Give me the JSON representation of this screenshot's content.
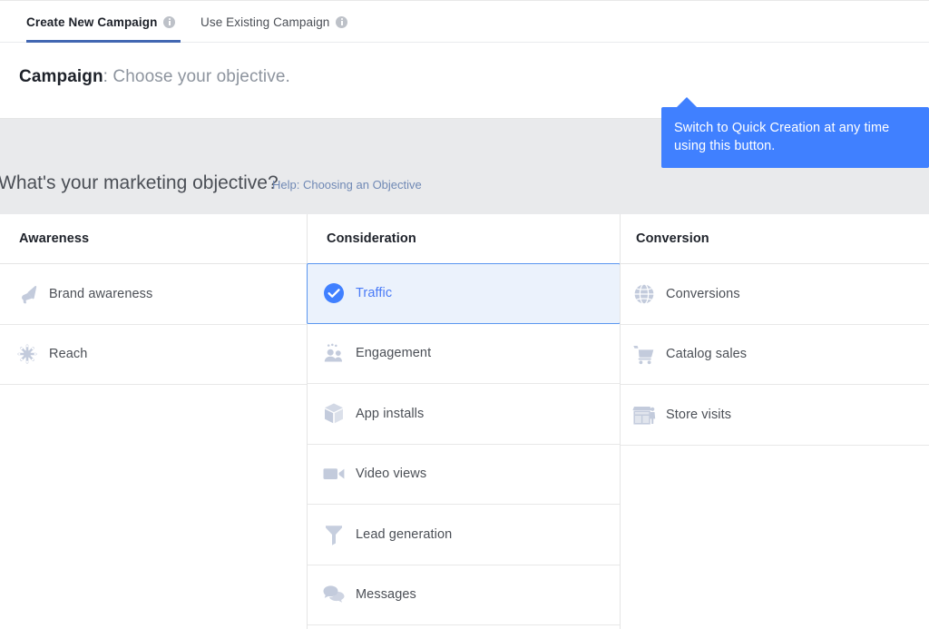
{
  "tabs": [
    {
      "label": "Create New Campaign",
      "icon": "info-icon",
      "active": true
    },
    {
      "label": "Use Existing Campaign",
      "icon": "info-icon",
      "active": false
    }
  ],
  "campaign_header": {
    "title_bold": "Campaign",
    "title_rest": ": Choose your objective.",
    "quick_creation_button": "Switch to Quick Creation"
  },
  "tooltip": {
    "text": "Switch to Quick Creation at any time using this button.",
    "background_color": "#4080ff",
    "text_color": "#ffffff"
  },
  "objective_section": {
    "question": "What's your marketing objective?",
    "help_link": "Help: Choosing an Objective",
    "band_color": "#e9eaec"
  },
  "columns": [
    {
      "header": "Awareness",
      "items": [
        {
          "label": "Brand awareness",
          "icon": "megaphone-icon",
          "selected": false
        },
        {
          "label": "Reach",
          "icon": "reach-burst-icon",
          "selected": false
        }
      ]
    },
    {
      "header": "Consideration",
      "items": [
        {
          "label": "Traffic",
          "icon": "check-circle-icon",
          "selected": true
        },
        {
          "label": "Engagement",
          "icon": "people-icon",
          "selected": false
        },
        {
          "label": "App installs",
          "icon": "cube-icon",
          "selected": false
        },
        {
          "label": "Video views",
          "icon": "video-camera-icon",
          "selected": false
        },
        {
          "label": "Lead generation",
          "icon": "funnel-icon",
          "selected": false
        },
        {
          "label": "Messages",
          "icon": "speech-bubbles-icon",
          "selected": false
        }
      ]
    },
    {
      "header": "Conversion",
      "items": [
        {
          "label": "Conversions",
          "icon": "globe-icon",
          "selected": false
        },
        {
          "label": "Catalog sales",
          "icon": "shopping-cart-icon",
          "selected": false
        },
        {
          "label": "Store visits",
          "icon": "storefront-icon",
          "selected": false
        }
      ]
    }
  ],
  "colors": {
    "accent_blue": "#4080ff",
    "tab_underline": "#4267b2",
    "selected_row_bg": "#ebf2fc",
    "selected_row_border": "#5a96f0",
    "icon_gray": "#c3cbdc",
    "text_primary": "#1d2129",
    "text_secondary": "#4b4f56",
    "link_blue": "#7089b5"
  }
}
